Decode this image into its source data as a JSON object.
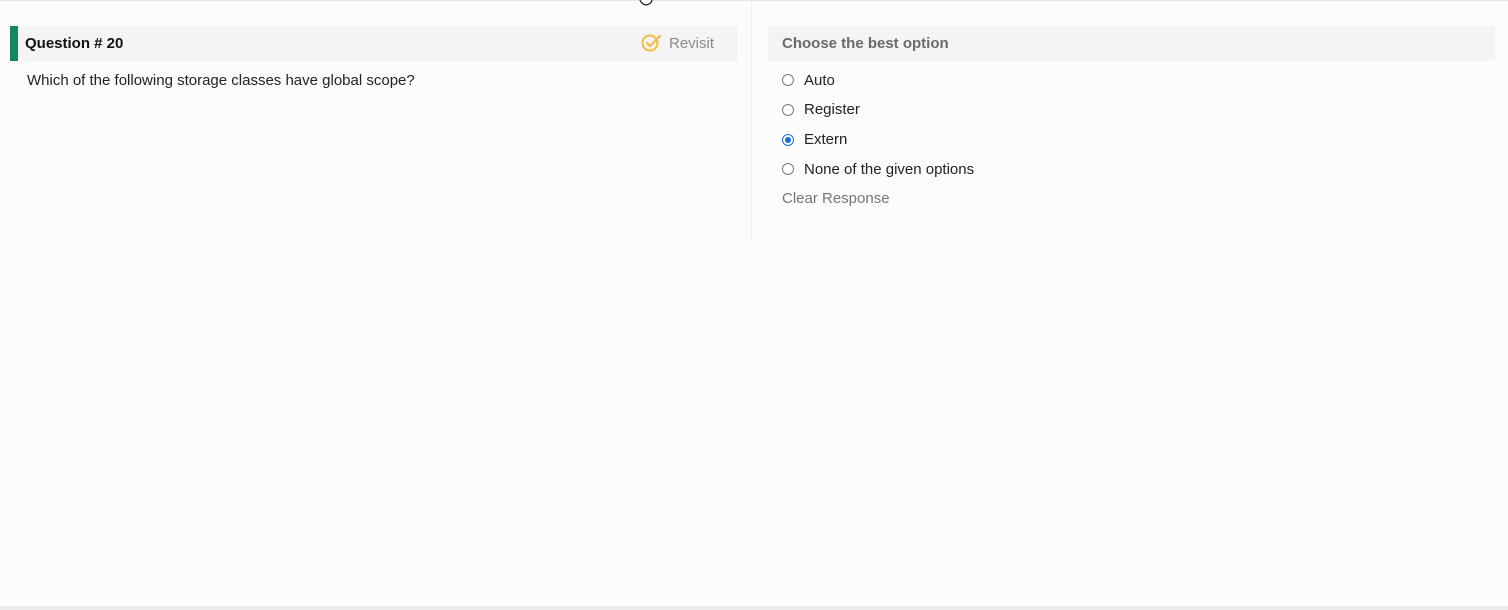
{
  "question": {
    "title": "Question # 20",
    "revisit_label": "Revisit",
    "text": "Which of the following storage classes have global scope?"
  },
  "answers": {
    "header": "Choose the best option",
    "options": [
      {
        "label": "Auto",
        "selected": false
      },
      {
        "label": "Register",
        "selected": false
      },
      {
        "label": "Extern",
        "selected": true
      },
      {
        "label": "None of the given options",
        "selected": false
      }
    ],
    "clear_label": "Clear Response"
  },
  "colors": {
    "accent": "#14875e",
    "radio_selected": "#1a6fd6",
    "revisit_icon": "#f5b942"
  },
  "icons": {
    "revisit": "pencil-check-icon",
    "cursor": "hand-cursor-icon"
  }
}
